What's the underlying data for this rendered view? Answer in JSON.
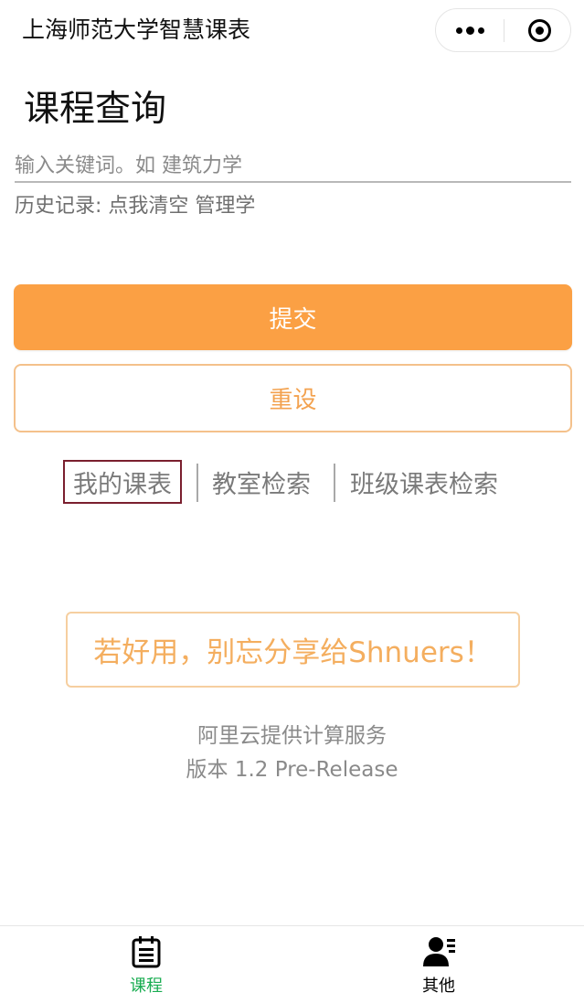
{
  "nav": {
    "title": "上海师范大学智慧课表"
  },
  "page": {
    "title": "课程查询"
  },
  "search": {
    "placeholder": "输入关键词。如 建筑力学",
    "value": ""
  },
  "history": {
    "label": "历史记录: ",
    "clear": "点我清空",
    "items": [
      "管理学"
    ]
  },
  "buttons": {
    "submit": "提交",
    "reset": "重设"
  },
  "links": [
    {
      "label": "我的课表",
      "active": true
    },
    {
      "label": "教室检索",
      "active": false
    },
    {
      "label": "班级课表检索",
      "active": false
    }
  ],
  "share": {
    "text": "若好用，别忘分享给Shnuers！"
  },
  "footer": {
    "credit": "阿里云提供计算服务",
    "version": "版本 1.2 Pre-Release"
  },
  "tabbar": {
    "tabs": [
      {
        "label": "课程",
        "icon": "notepad-icon",
        "active": true
      },
      {
        "label": "其他",
        "icon": "user-list-icon",
        "active": false
      }
    ]
  },
  "colors": {
    "accent": "#fba044",
    "active_tab": "#1aad52",
    "active_link_border": "#7a1f2e"
  }
}
